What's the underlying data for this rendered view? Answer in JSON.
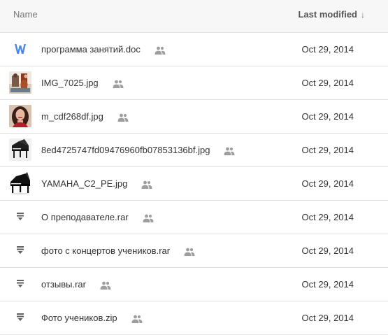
{
  "header": {
    "name_label": "Name",
    "modified_label": "Last modified",
    "sort_arrow": "↓"
  },
  "files": [
    {
      "name": "программа занятий.doc",
      "date": "Oct 29, 2014",
      "icon": "word-doc-icon"
    },
    {
      "name": "IMG_7025.jpg",
      "date": "Oct 29, 2014",
      "icon": "image-thumbnail"
    },
    {
      "name": "m_cdf268df.jpg",
      "date": "Oct 29, 2014",
      "icon": "image-thumbnail"
    },
    {
      "name": "8ed4725747fd09476960fb07853136bf.jpg",
      "date": "Oct 29, 2014",
      "icon": "image-thumbnail"
    },
    {
      "name": "YAMAHA_C2_PE.jpg",
      "date": "Oct 29, 2014",
      "icon": "image-thumbnail"
    },
    {
      "name": "О преподавателе.rar",
      "date": "Oct 29, 2014",
      "icon": "archive-icon"
    },
    {
      "name": "фото с концертов учеников.rar",
      "date": "Oct 29, 2014",
      "icon": "archive-icon"
    },
    {
      "name": "отзывы.rar",
      "date": "Oct 29, 2014",
      "icon": "archive-icon"
    },
    {
      "name": "Фото учеников.zip",
      "date": "Oct 29, 2014",
      "icon": "archive-icon"
    }
  ],
  "colors": {
    "word_blue": "#4a86e8",
    "shared_icon": "#9e9e9e",
    "archive_icon": "#616161"
  }
}
